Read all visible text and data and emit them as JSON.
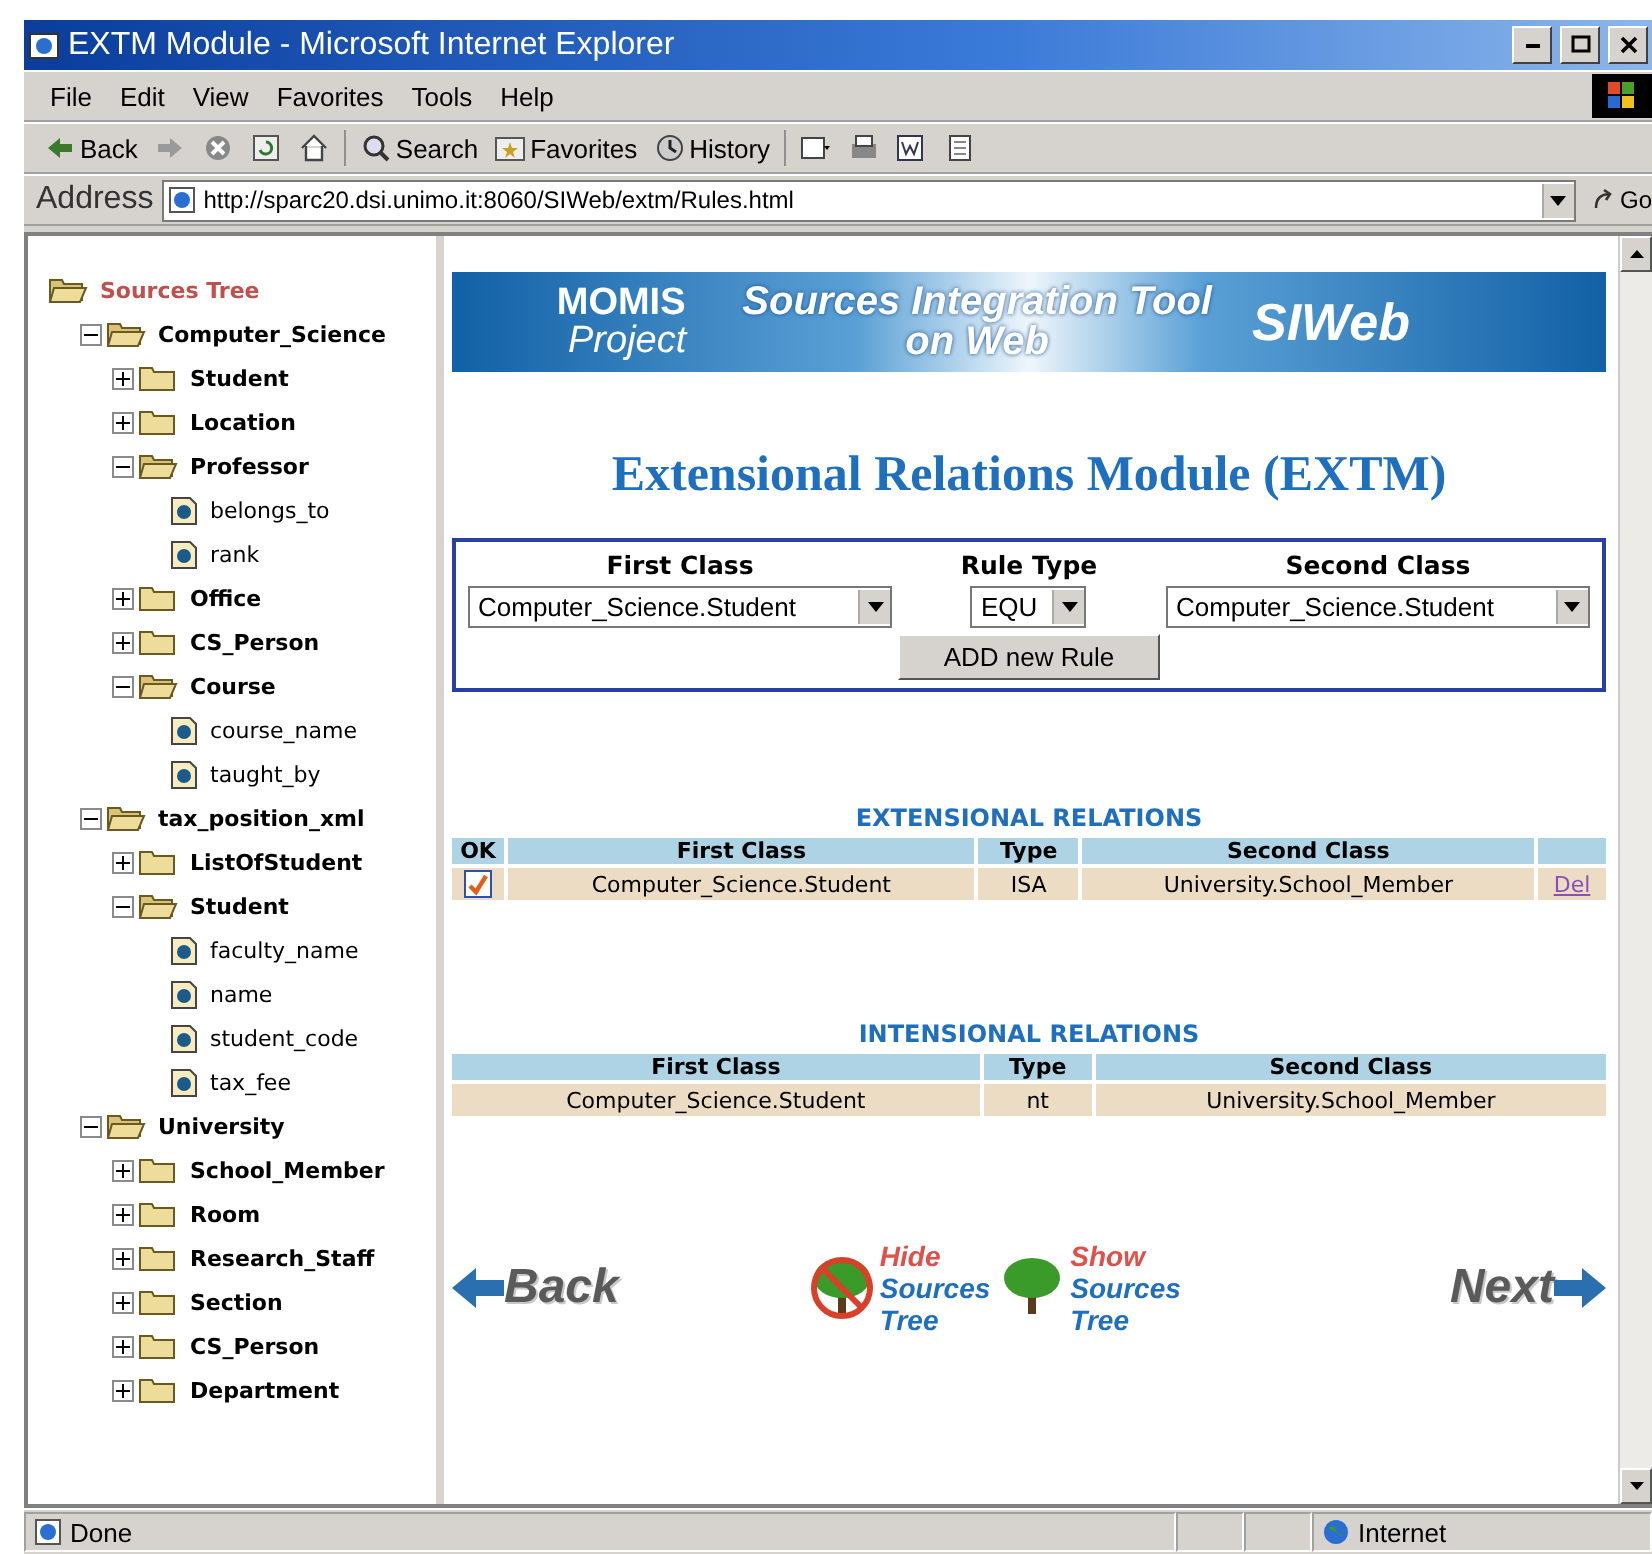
{
  "window": {
    "title": "EXTM Module - Microsoft Internet Explorer"
  },
  "menu": [
    "File",
    "Edit",
    "View",
    "Favorites",
    "Tools",
    "Help"
  ],
  "toolbar": [
    {
      "kind": "back",
      "label": "Back"
    },
    {
      "kind": "forward"
    },
    {
      "kind": "stop"
    },
    {
      "kind": "refresh"
    },
    {
      "kind": "home"
    },
    {
      "kind": "search",
      "label": "Search"
    },
    {
      "kind": "favorites",
      "label": "Favorites"
    },
    {
      "kind": "history",
      "label": "History"
    },
    {
      "kind": "mail"
    },
    {
      "kind": "print"
    },
    {
      "kind": "edit"
    },
    {
      "kind": "discuss"
    }
  ],
  "address": {
    "label": "Address",
    "value": "http://sparc20.dsi.unimo.it:8060/SIWeb/extm/Rules.html",
    "go": "Go"
  },
  "sources_tree": {
    "title": "Sources Tree",
    "items": [
      {
        "label": "Computer_Science",
        "kind": "folder",
        "expanded": true,
        "children": [
          {
            "label": "Student",
            "kind": "folder",
            "expanded": false
          },
          {
            "label": "Location",
            "kind": "folder",
            "expanded": false
          },
          {
            "label": "Professor",
            "kind": "folder",
            "expanded": true,
            "children": [
              {
                "label": "belongs_to",
                "kind": "field"
              },
              {
                "label": "rank",
                "kind": "field"
              }
            ]
          },
          {
            "label": "Office",
            "kind": "folder",
            "expanded": false
          },
          {
            "label": "CS_Person",
            "kind": "folder",
            "expanded": false
          },
          {
            "label": "Course",
            "kind": "folder",
            "expanded": true,
            "children": [
              {
                "label": "course_name",
                "kind": "field"
              },
              {
                "label": "taught_by",
                "kind": "field"
              }
            ]
          }
        ]
      },
      {
        "label": "tax_position_xml",
        "kind": "folder",
        "expanded": true,
        "children": [
          {
            "label": "ListOfStudent",
            "kind": "folder",
            "expanded": false
          },
          {
            "label": "Student",
            "kind": "folder",
            "expanded": true,
            "children": [
              {
                "label": "faculty_name",
                "kind": "field"
              },
              {
                "label": "name",
                "kind": "field"
              },
              {
                "label": "student_code",
                "kind": "field"
              },
              {
                "label": "tax_fee",
                "kind": "field"
              }
            ]
          }
        ]
      },
      {
        "label": "University",
        "kind": "folder",
        "expanded": true,
        "children": [
          {
            "label": "School_Member",
            "kind": "folder",
            "expanded": false
          },
          {
            "label": "Room",
            "kind": "folder",
            "expanded": false
          },
          {
            "label": "Research_Staff",
            "kind": "folder",
            "expanded": false
          },
          {
            "label": "Section",
            "kind": "folder",
            "expanded": false
          },
          {
            "label": "CS_Person",
            "kind": "folder",
            "expanded": false
          },
          {
            "label": "Department",
            "kind": "folder",
            "expanded": false
          }
        ]
      }
    ]
  },
  "banner": {
    "project_name": "MOMIS",
    "project_label": "Project",
    "tagline_1": "Sources Integration Tool",
    "tagline_2": "on Web",
    "product": "SIWeb"
  },
  "heading": "Extensional Relations Module (EXTM)",
  "rule_form": {
    "fields": [
      {
        "label": "First Class",
        "value": "Computer_Science.Student",
        "kind": "wide"
      },
      {
        "label": "Rule Type",
        "value": "EQU",
        "kind": "narrow"
      },
      {
        "label": "Second Class",
        "value": "Computer_Science.Student",
        "kind": "wide"
      }
    ],
    "button": "ADD new Rule"
  },
  "extensional_relations": {
    "title": "EXTENSIONAL RELATIONS",
    "columns": [
      "OK",
      "First Class",
      "Type",
      "Second Class"
    ],
    "rows": [
      {
        "ok": true,
        "first_class": "Computer_Science.Student",
        "type": "ISA",
        "second_class": "University.School_Member",
        "action": "Del"
      }
    ]
  },
  "intensional_relations": {
    "title": "INTENSIONAL RELATIONS",
    "columns": [
      "First Class",
      "Type",
      "Second Class"
    ],
    "rows": [
      {
        "first_class": "Computer_Science.Student",
        "type": "nt",
        "second_class": "University.School_Member"
      }
    ]
  },
  "navigation": {
    "back": "Back",
    "hide_tree": {
      "action": "Hide",
      "line_1": "Sources",
      "line_2": "Tree"
    },
    "show_tree": {
      "action": "Show",
      "line_1": "Sources",
      "line_2": "Tree"
    },
    "next": "Next"
  },
  "status_bar": {
    "text": "Done",
    "zone": "Internet"
  }
}
